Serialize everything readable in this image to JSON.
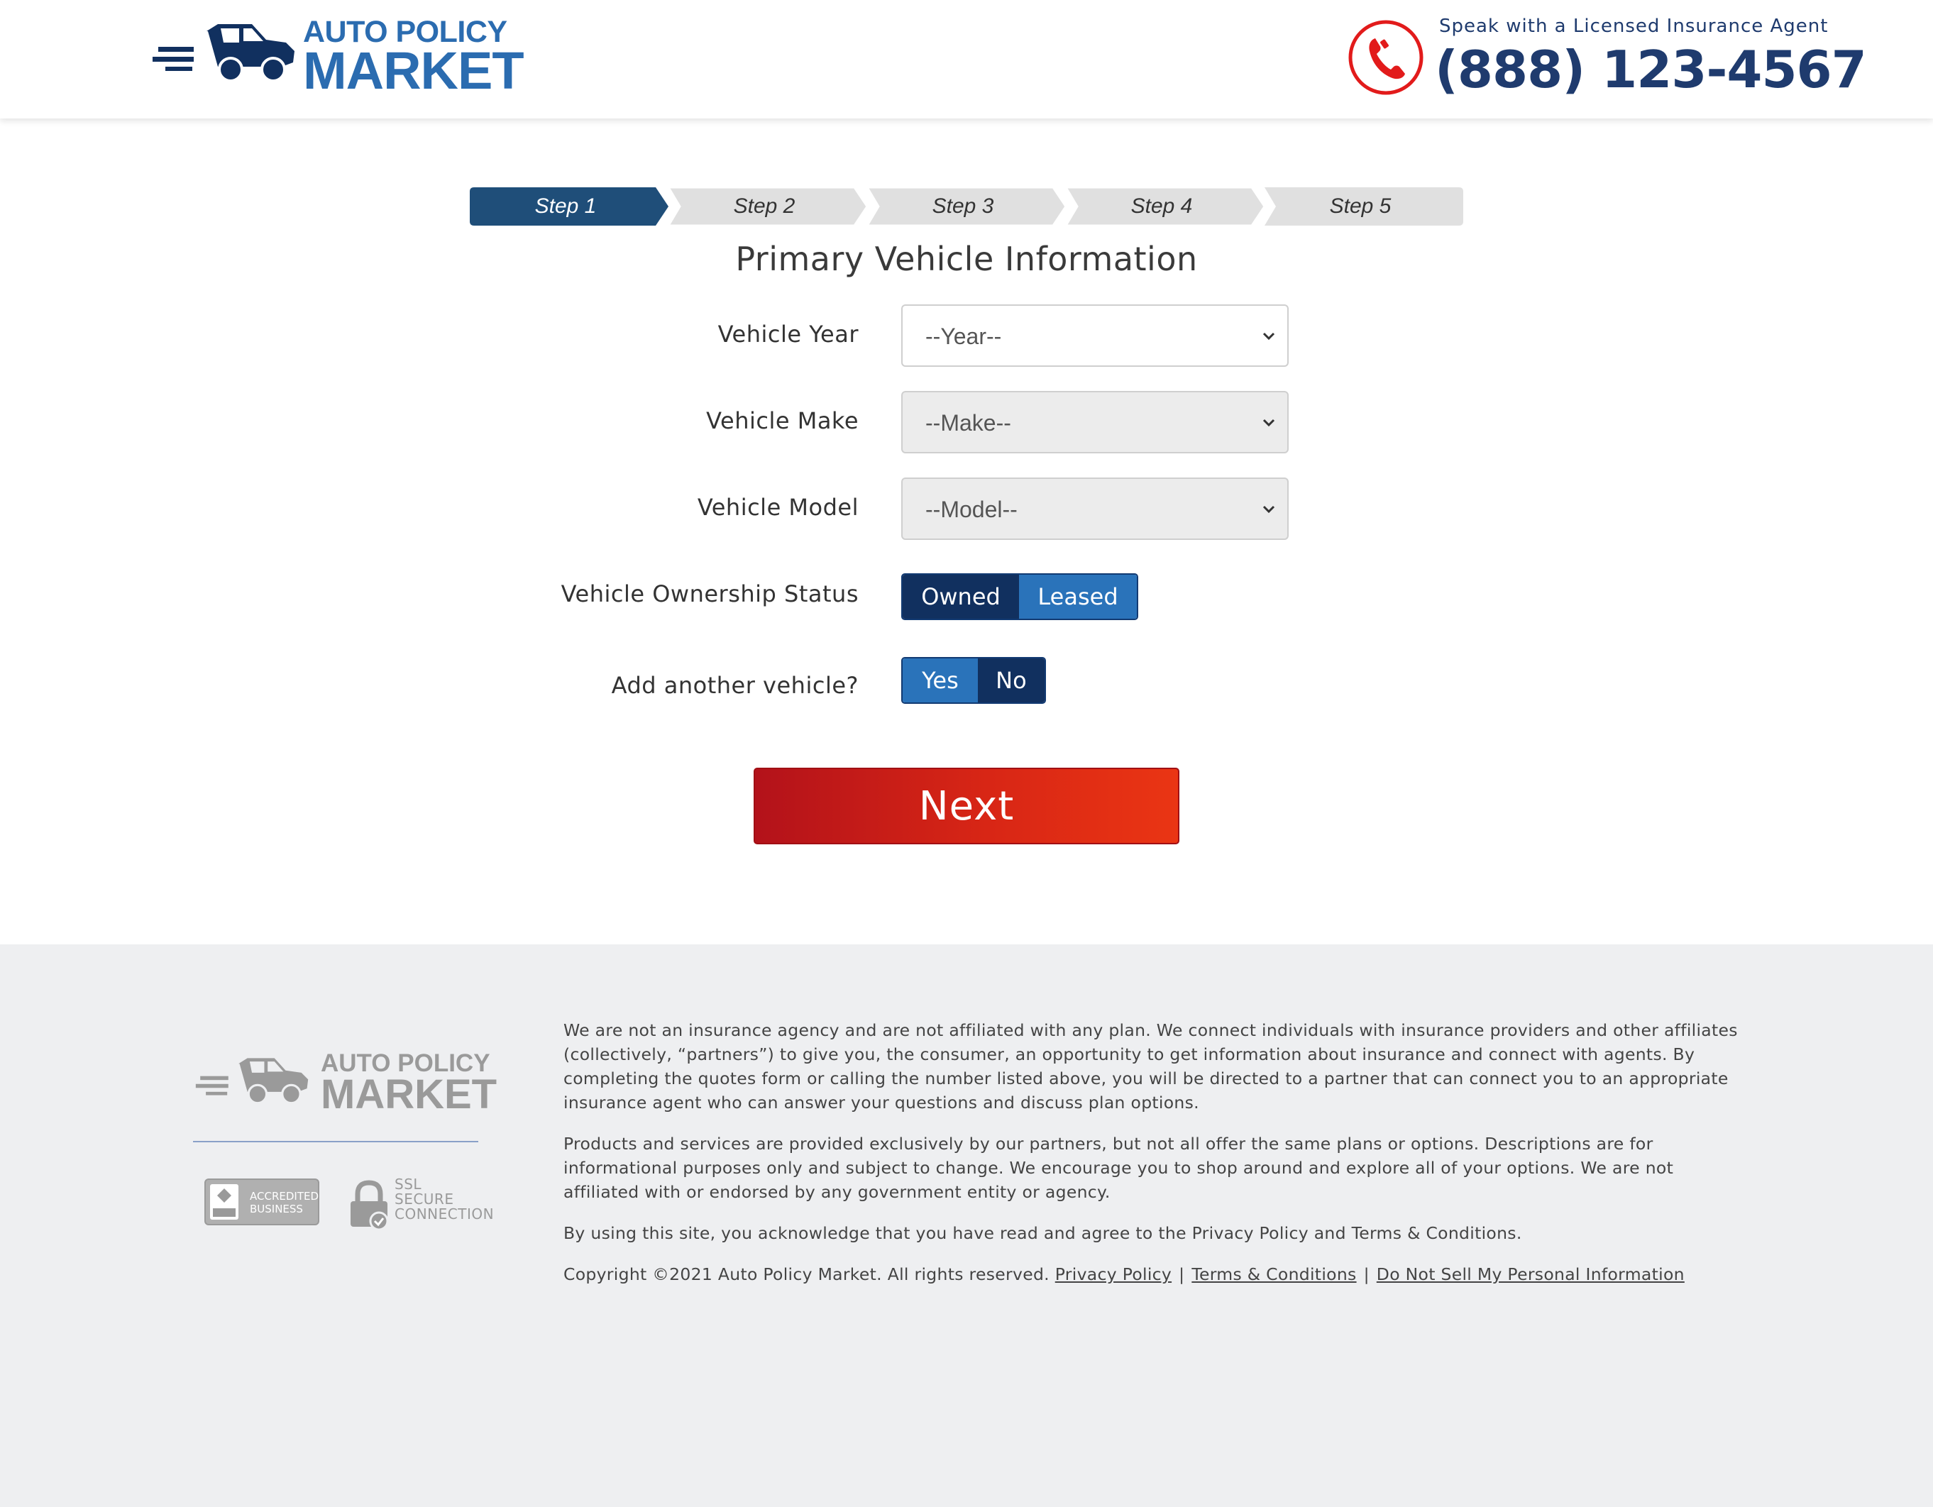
{
  "header": {
    "logo_line1": "AUTO POLICY",
    "logo_line2": "MARKET",
    "phone_caption": "Speak with a Licensed Insurance Agent",
    "phone_number": "(888) 123-4567"
  },
  "steps": [
    "Step 1",
    "Step 2",
    "Step 3",
    "Step 4",
    "Step 5"
  ],
  "active_step_index": 0,
  "form": {
    "title": "Primary Vehicle Information",
    "year_label": "Vehicle Year",
    "year_value": "--Year--",
    "make_label": "Vehicle Make",
    "make_value": "--Make--",
    "model_label": "Vehicle Model",
    "model_value": "--Model--",
    "ownership_label": "Vehicle Ownership Status",
    "ownership_options": [
      "Owned",
      "Leased"
    ],
    "another_label": "Add another vehicle?",
    "another_options": [
      "Yes",
      "No"
    ],
    "next_label": "Next"
  },
  "footer": {
    "logo_line1": "AUTO POLICY",
    "logo_line2": "MARKET",
    "bbb_text_1": "ACCREDITED",
    "bbb_text_2": "BUSINESS",
    "bbb_seal": "BBB",
    "ssl_1": "SSL",
    "ssl_2": "SECURE",
    "ssl_3": "CONNECTION",
    "para1": "We are not an insurance agency and are not affiliated with any plan. We connect individuals with insurance providers and other affiliates (collectively, “partners”) to give you, the consumer, an opportunity to get information about insurance and connect with agents. By completing the quotes form or calling the number listed above, you will be directed to a partner that can connect you to an appropriate insurance agent who can answer your questions and discuss plan options.",
    "para2": "Products and services are provided exclusively by our partners, but not all offer the same plans or options. Descriptions are for informational purposes only and subject to change. We encourage you to shop around and explore all of your options. We are not affiliated with or endorsed by any government entity or agency.",
    "para3": "By using this site, you acknowledge that you have read and agree to the Privacy Policy and Terms & Conditions.",
    "copyright": "Copyright ©2021 Auto Policy Market. All rights reserved.",
    "link_privacy": "Privacy Policy",
    "link_terms": "Terms & Conditions",
    "link_dnsmpi": "Do Not Sell My Personal Information",
    "separator": "|"
  },
  "colors": {
    "brand_blue": "#2b6cb0",
    "navy": "#11305f",
    "toggle_light": "#2a73ba",
    "step_active": "#1f4e79",
    "step_inactive": "#e0e0e0",
    "cta_red": "#d82615",
    "phone_red": "#e21b1b",
    "footer_bg": "#eeeff1"
  },
  "icons": {
    "logo": "car-icon",
    "phone": "phone-icon",
    "chevron": "chevron-down-icon",
    "ssl": "lock-icon"
  }
}
